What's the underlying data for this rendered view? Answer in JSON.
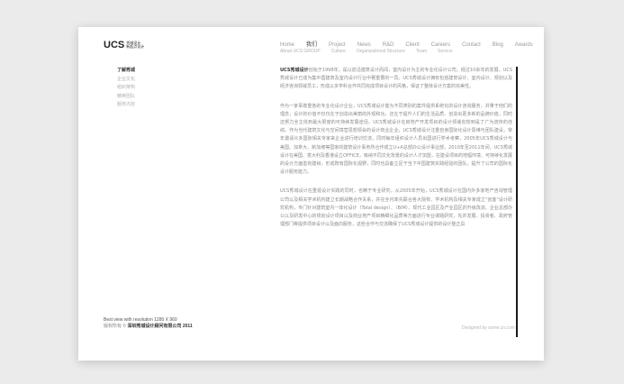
{
  "logo": {
    "mark": "UCS",
    "line1": "秀城设计",
    "line2": "新起点设计"
  },
  "nav": {
    "main": [
      {
        "label": "Home",
        "active": false
      },
      {
        "label": "我们",
        "active": true
      },
      {
        "label": "Project",
        "active": false
      },
      {
        "label": "News",
        "active": false
      },
      {
        "label": "R&D",
        "active": false
      },
      {
        "label": "Client",
        "active": false
      },
      {
        "label": "Careers",
        "active": false
      },
      {
        "label": "Contact",
        "active": false
      },
      {
        "label": "Blog",
        "active": false
      },
      {
        "label": "Awards",
        "active": false
      }
    ],
    "sub": [
      "About UCS GROUP",
      "Culture",
      "Organizational Structure",
      "Team",
      "Service"
    ]
  },
  "sidebar": {
    "items": [
      {
        "label": "了解秀城",
        "active": true
      },
      {
        "label": "企业文化",
        "active": false
      },
      {
        "label": "组织架构",
        "active": false
      },
      {
        "label": "精英团队",
        "active": false
      },
      {
        "label": "服务内容",
        "active": false
      }
    ]
  },
  "content": {
    "p1_lead": "UCS秀城设计",
    "p1_text": "创始于1998年，是以前沿建筑设计而闻，室内设计为主的专业化设计公司。经过10余年的发展，UCS秀城设计已成为集中国建筑及室内设计行业中著重要的一员。UCS秀城设计拥有包括建筑设计、室内设计、规划以及经济咨询领域员工，形成以多学科合作共同完成项目设计的风格，保证了整体设计方案的完美性。",
    "p2_text": "作为一家事尊重各的专业化设计企业，UCS秀城设计能为不同类别的案件提供系统化的设计咨询服务，并秉于他们的理念，设计的价值不仅仅在于创造出美丽的外观和功，还在于提升人们的生活品质、创造出更多新的品牌价值，同时还努力全主伐到最大限度的可持续发展途径。UCS秀城设计在房地产开发项目的设计领域省较到是了广为流传的佳绩。作为当代建筑文化与空间境营思想领会的设计商业企业，UCS秀城设计注重自身国际化设计思维与团队建设，常年邀请众多国际相关专家来企业进行培训交流，同时每年组织设计人员出国进行学术考察，2005年UCS秀城设计与美国、加拿大、新加坡等国家的建筑设计事务所合作成立U+A总部办公设计事业部，2010年至2011年间，UCS秀城设计在美国、意大利及香港设立OFFICE，吸纳不同文化背景的设计人才加盟，在建设项目的地辐环境、可持续化发展的设计方面善有建树，形成既有国际化视野，同时也具备立足于当下中国建筑实践经验的团队，提升了公司的国际化设计服务能力。",
    "p3_text": "UCS秀城设计在重视设计实践的同时，也精于专业研究，从2005年开始，UCS秀城设计在国内外多家地产咨询管理公司以及相关学术机构建立长期战略合作关系，并在全内率先联合各大院校、学术机构及相关专家成立\"创客\"设计研究机构，专门针对建筑室内一体化设计（Total design）、（BIM）、现代工业园区及产业园区的升级改造、企业总部办公以及研发中心的规划设计项目以及商业地产项目精细化品质等方面进行专业课题研究，先并发展、投资者、政府管理部门等提供项目设计以及面向服务，这些合作与交流确保了UCS秀城设计提供的设计整正具"
  },
  "footer": {
    "resolution": "Best view with resolution 1280 X 960",
    "copyright_prefix": "版权所有 ©",
    "copyright_company": "深圳秀城设计顾问有限公司 2011",
    "credit": "Designed by some.cn.com"
  }
}
